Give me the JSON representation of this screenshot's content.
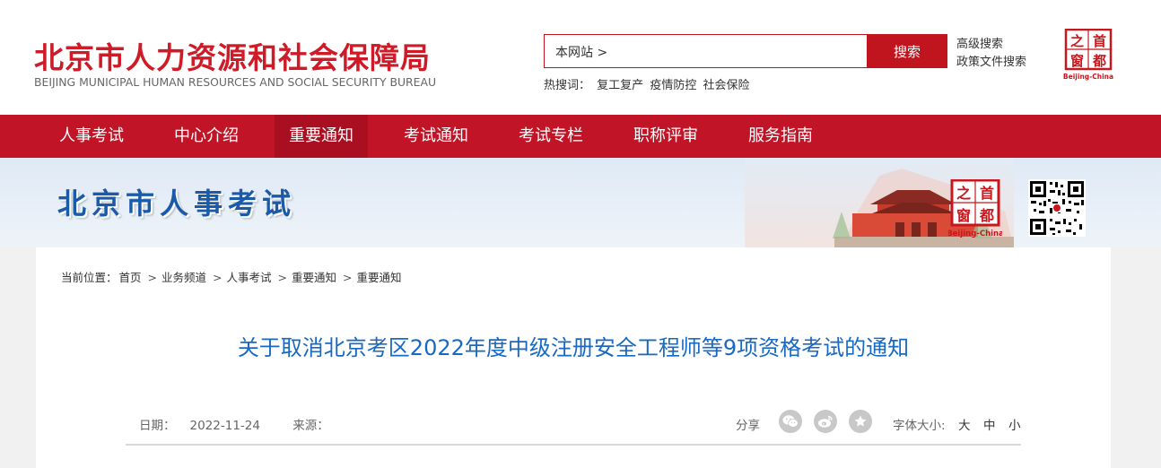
{
  "header": {
    "title": "北京市人力资源和社会保障局",
    "subtitle": "BEIJING MUNICIPAL HUMAN RESOURCES AND SOCIAL SECURITY BUREAU",
    "search": {
      "scope": "本网站 >",
      "button": "搜索"
    },
    "hot_label": "热搜词：",
    "hot_words": [
      "复工复产",
      "疫情防控",
      "社会保险"
    ],
    "advanced_search": "高级搜索",
    "policy_search": "政策文件搜索",
    "seal": {
      "chars": [
        "之",
        "首",
        "窗",
        "都"
      ],
      "caption": "Beijing-China"
    }
  },
  "nav": {
    "items": [
      {
        "label": "人事考试"
      },
      {
        "label": "中心介绍"
      },
      {
        "label": "重要通知",
        "active": true
      },
      {
        "label": "考试通知"
      },
      {
        "label": "考试专栏"
      },
      {
        "label": "职称评审"
      },
      {
        "label": "服务指南"
      }
    ]
  },
  "banner": {
    "title": "北京市人事考试",
    "seal": {
      "chars": [
        "之",
        "首",
        "窗",
        "都"
      ],
      "caption": "Beijing-China"
    }
  },
  "breadcrumb": {
    "label": "当前位置：",
    "items": [
      "首页",
      "业务频道",
      "人事考试",
      "重要通知",
      "重要通知"
    ],
    "separator": ">"
  },
  "article": {
    "title": "关于取消北京考区2022年度中级注册安全工程师等9项资格考试的通知",
    "date_label": "日期：",
    "date": "2022-11-24",
    "source_label": "来源：",
    "source": "",
    "share_label": "分享",
    "share_icons": [
      "wechat-icon",
      "weibo-icon",
      "favorite-icon"
    ],
    "font_size_label": "字体大小:",
    "font_sizes": [
      "大",
      "中",
      "小"
    ]
  },
  "colors": {
    "brand_red": "#c21427",
    "title_blue": "#1769c4",
    "banner_blue": "#1a5aa8"
  }
}
